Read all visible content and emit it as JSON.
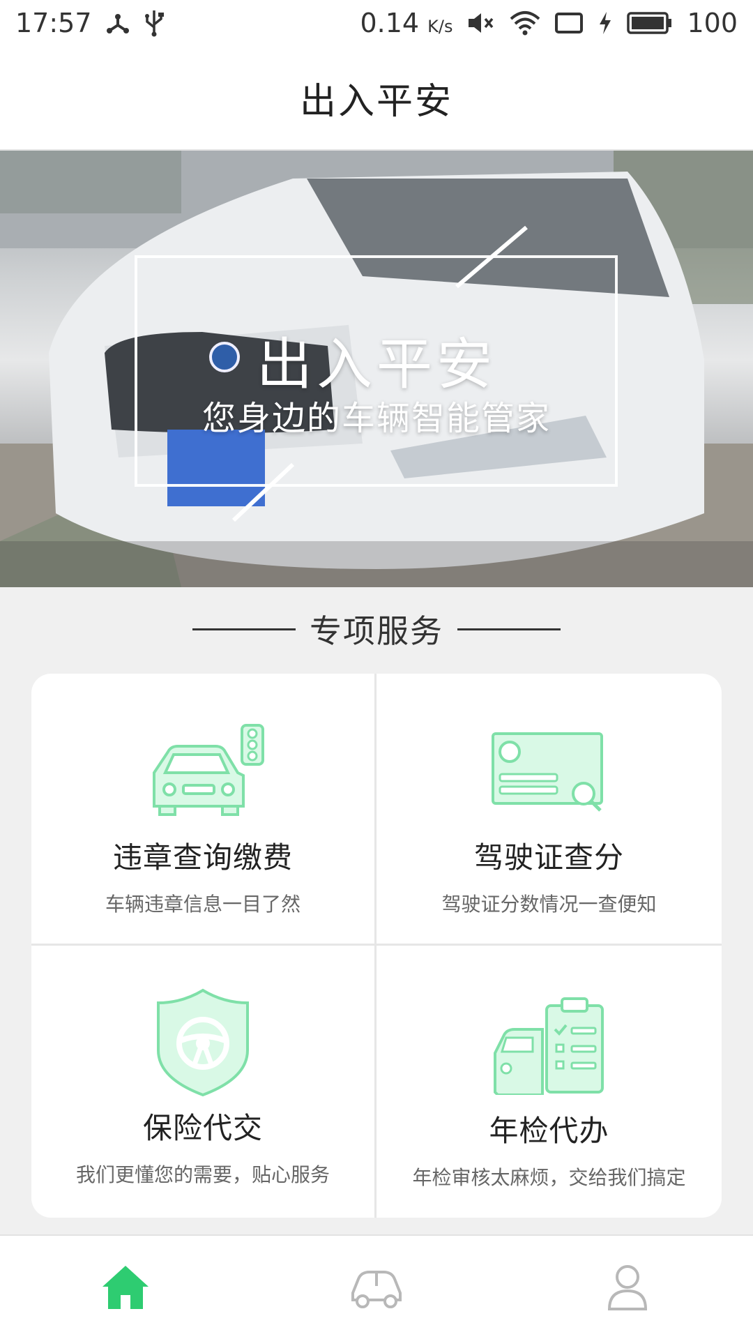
{
  "status_bar": {
    "time": "17:57",
    "network_speed": "0.14",
    "network_speed_unit": "K/s",
    "battery": "100",
    "icons": [
      "nodes-icon",
      "usb-icon",
      "mute-icon",
      "wifi-icon",
      "screen-icon",
      "charging-icon",
      "battery-icon"
    ]
  },
  "header": {
    "title": "出入平安"
  },
  "banner": {
    "title": "出入平安",
    "subtitle": "您身边的车辆智能管家"
  },
  "section": {
    "title": "专项服务"
  },
  "services": [
    {
      "title": "违章查询缴费",
      "desc": "车辆违章信息一目了然",
      "icon": "car-traffic-light-icon"
    },
    {
      "title": "驾驶证查分",
      "desc": "驾驶证分数情况一查便知",
      "icon": "license-search-icon"
    },
    {
      "title": "保险代交",
      "desc": "我们更懂您的需要，贴心服务",
      "icon": "shield-steering-wheel-icon"
    },
    {
      "title": "年检代办",
      "desc": "年检审核太麻烦，交给我们搞定",
      "icon": "car-checklist-icon"
    }
  ],
  "bottom_nav": [
    {
      "icon": "home-icon",
      "active": true
    },
    {
      "icon": "car-icon",
      "active": false
    },
    {
      "icon": "user-icon",
      "active": false
    }
  ],
  "colors": {
    "accent": "#2ecc71",
    "icon_fill": "#d9f9e6",
    "icon_stroke": "#7fe0a8",
    "inactive_icon": "#b8b8b8"
  }
}
